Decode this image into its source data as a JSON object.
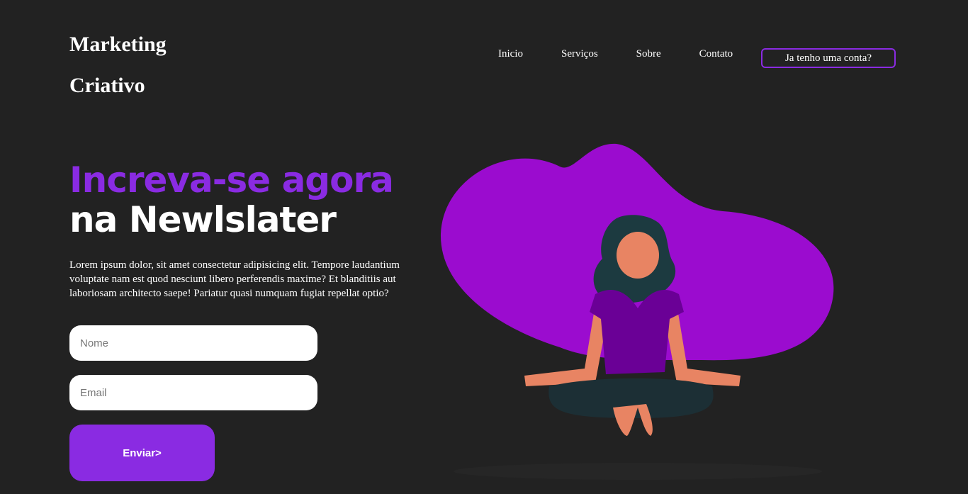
{
  "logo": {
    "line1": "Marketing",
    "line2": "Criativo"
  },
  "nav": {
    "items": [
      "Inicio",
      "Serviços",
      "Sobre",
      "Contato"
    ],
    "login": "Ja tenho uma conta?"
  },
  "hero": {
    "title_accent": "Increva-se agora",
    "title_main": "na Newlslater",
    "description": "Lorem ipsum dolor, sit amet consectetur adipisicing elit. Tempore laudantium voluptate nam est quod nesciunt libero perferendis maxime? Et blanditiis aut laboriosam architecto saepe! Pariatur quasi numquam fugiat repellat optio?"
  },
  "form": {
    "name_placeholder": "Nome",
    "email_placeholder": "Email",
    "submit": "Enviar>"
  },
  "colors": {
    "accent": "#8a2be2",
    "blob": "#9b0ccf",
    "background": "#222222"
  }
}
